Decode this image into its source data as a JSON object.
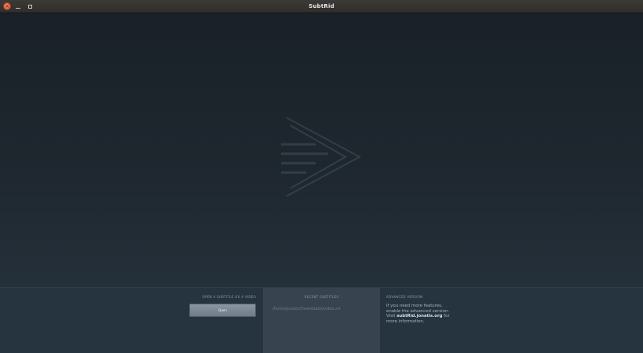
{
  "window": {
    "title": "SubtRid",
    "close_glyph": "×",
    "minimize_label": "minimize",
    "maximize_label": "maximize"
  },
  "main": {
    "logo_icon": "subtitle-arrow-logo-icon"
  },
  "bottom": {
    "open_section": {
      "title": "OPEN A SUBTITLE OR A VIDEO",
      "button_label": "Open"
    },
    "recent_section": {
      "title": "RECENT SUBTITLES",
      "items": [
        "/home/jonatis/Downloads/video.srt"
      ]
    },
    "advanced_section": {
      "title": "ADVANCED VERSION",
      "line1": "If you need more features,",
      "line2": "enable the advanced version.",
      "visit_prefix": "Visit ",
      "visit_link": "subtRid.jonatis.org",
      "visit_suffix": " for",
      "line4": "more information."
    }
  },
  "colors": {
    "background": "#1c252d",
    "panel": "#263440",
    "recent_panel": "#37434e",
    "close_button": "#e06b44"
  }
}
